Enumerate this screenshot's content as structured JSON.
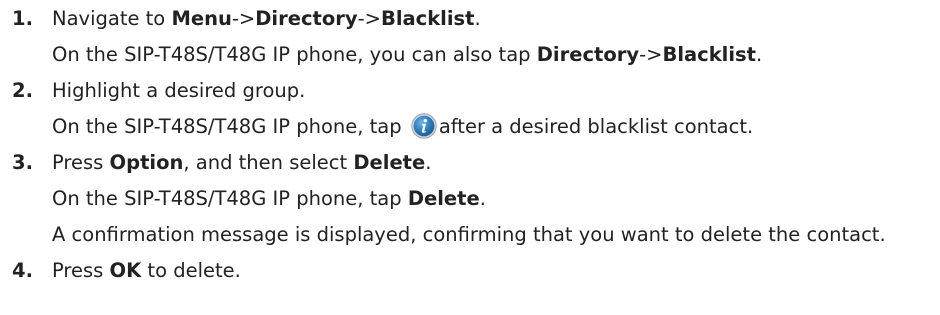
{
  "steps": [
    {
      "number": "1.",
      "text": [
        "Navigate to ",
        "Menu",
        "->",
        "Directory",
        "->",
        "Blacklist",
        "."
      ],
      "note": [
        "On the SIP-T48S/T48G IP phone, you can also tap ",
        "Directory",
        "->",
        "Blacklist",
        "."
      ]
    },
    {
      "number": "2.",
      "text": "Highlight a desired group.",
      "note": [
        "On the SIP-T48S/T48G IP phone, tap ",
        "after a desired blacklist contact."
      ],
      "note_icon": "info-icon"
    },
    {
      "number": "3.",
      "text": [
        "Press ",
        "Option",
        ", and then select ",
        "Delete",
        "."
      ],
      "note": [
        "On the SIP-T48S/T48G IP phone, tap ",
        "Delete",
        "."
      ],
      "note2": "A confirmation message is displayed, confirming that you want to delete the contact."
    },
    {
      "number": "4.",
      "text": [
        "Press ",
        "OK",
        " to delete."
      ]
    }
  ],
  "colors": {
    "text": "#222222",
    "icon_blue": "#2f7fc0",
    "icon_ring": "#9aa4ad"
  }
}
